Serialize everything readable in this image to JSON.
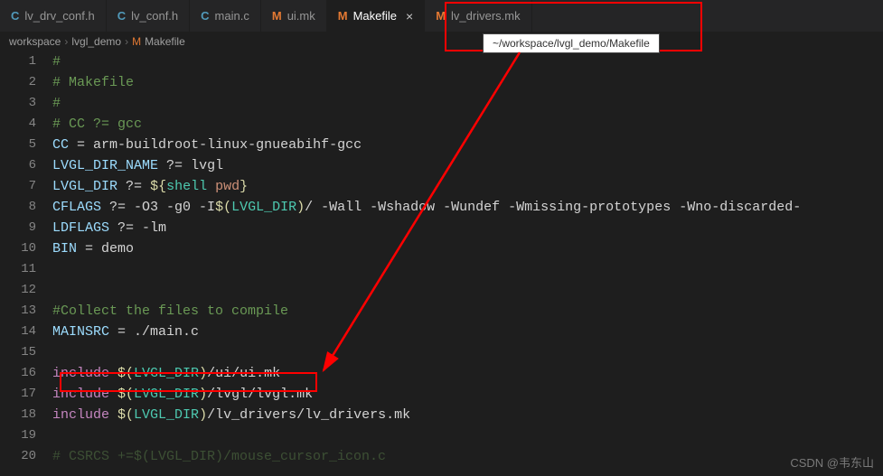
{
  "tabs": [
    {
      "icon": "C",
      "iconClass": "icon-c",
      "label": "lv_drv_conf.h",
      "active": false
    },
    {
      "icon": "C",
      "iconClass": "icon-c",
      "label": "lv_conf.h",
      "active": false
    },
    {
      "icon": "C",
      "iconClass": "icon-c",
      "label": "main.c",
      "active": false
    },
    {
      "icon": "M",
      "iconClass": "icon-m",
      "label": "ui.mk",
      "active": false
    },
    {
      "icon": "M",
      "iconClass": "icon-m",
      "label": "Makefile",
      "active": true,
      "closable": true
    },
    {
      "icon": "M",
      "iconClass": "icon-m",
      "label": "lv_drivers.mk",
      "active": false
    }
  ],
  "breadcrumb": {
    "parts": [
      "workspace",
      "lvgl_demo"
    ],
    "fileIcon": "M",
    "fileName": "Makefile"
  },
  "tooltip": "~/workspace/lvgl_demo/Makefile",
  "watermark": "CSDN @韦东山",
  "code": {
    "lines": [
      {
        "n": 1,
        "html": "<span class='tok-comment'>#</span>"
      },
      {
        "n": 2,
        "html": "<span class='tok-comment'># Makefile</span>"
      },
      {
        "n": 3,
        "html": "<span class='tok-comment'>#</span>"
      },
      {
        "n": 4,
        "html": "<span class='tok-comment'># CC ?= gcc</span>"
      },
      {
        "n": 5,
        "html": "<span class='tok-var'>CC</span> <span class='tok-op'>=</span> arm-buildroot-linux-gnueabihf-gcc"
      },
      {
        "n": 6,
        "html": "<span class='tok-var'>LVGL_DIR_NAME</span> <span class='tok-op'>?=</span> lvgl"
      },
      {
        "n": 7,
        "html": "<span class='tok-var'>LVGL_DIR</span> <span class='tok-op'>?=</span> <span class='tok-deref'>${</span><span class='tok-inner'>shell</span> <span class='tok-str'>pwd</span><span class='tok-deref'>}</span>"
      },
      {
        "n": 8,
        "html": "<span class='tok-var'>CFLAGS</span> <span class='tok-op'>?=</span> -O3 -g0 -I<span class='tok-deref'>$(</span><span class='tok-inner'>LVGL_DIR</span><span class='tok-deref'>)</span>/ -Wall -Wshadow -Wundef -Wmissing-prototypes -Wno-discarded-"
      },
      {
        "n": 9,
        "html": "<span class='tok-var'>LDFLAGS</span> <span class='tok-op'>?=</span> -lm"
      },
      {
        "n": 10,
        "html": "<span class='tok-var'>BIN</span> <span class='tok-op'>=</span> demo"
      },
      {
        "n": 11,
        "html": ""
      },
      {
        "n": 12,
        "html": ""
      },
      {
        "n": 13,
        "html": "<span class='tok-comment'>#Collect the files to compile</span>"
      },
      {
        "n": 14,
        "html": "<span class='tok-var'>MAINSRC</span> <span class='tok-op'>=</span> ./main.c"
      },
      {
        "n": 15,
        "html": ""
      },
      {
        "n": 16,
        "html": "<span class='tok-kw'>include</span> <span class='tok-deref'>$(</span><span class='tok-inner'>LVGL_DIR</span><span class='tok-deref'>)</span>/ui/ui.mk"
      },
      {
        "n": 17,
        "html": "<span class='tok-kw'>include</span> <span class='tok-deref'>$(</span><span class='tok-inner'>LVGL_DIR</span><span class='tok-deref'>)</span>/lvgl/lvgl.mk"
      },
      {
        "n": 18,
        "html": "<span class='tok-kw'>include</span> <span class='tok-deref'>$(</span><span class='tok-inner'>LVGL_DIR</span><span class='tok-deref'>)</span>/lv_drivers/lv_drivers.mk"
      },
      {
        "n": 19,
        "html": ""
      },
      {
        "n": 20,
        "html": "<span class='tok-comment' style='opacity:.4'># CSRCS +=$(LVGL_DIR)/mouse_cursor_icon.c</span>"
      }
    ]
  }
}
